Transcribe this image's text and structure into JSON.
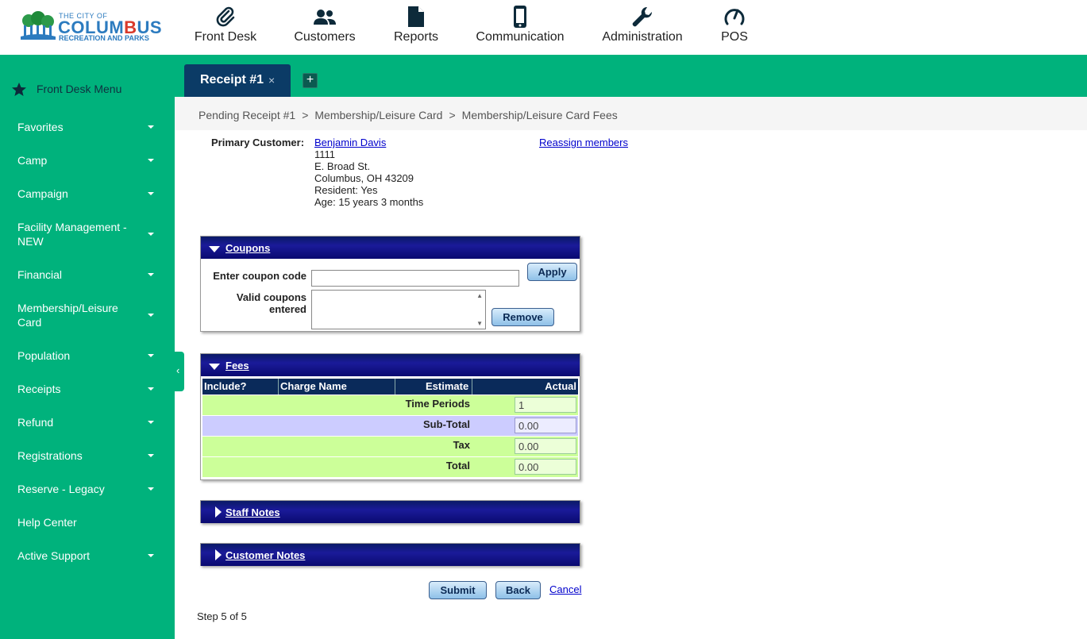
{
  "logo": {
    "line1": "THE CITY OF",
    "line2_a": "COLUM",
    "line2_b": "B",
    "line2_c": "US",
    "line3": "RECREATION AND PARKS"
  },
  "top_nav": [
    {
      "label": "Front Desk",
      "icon": "paperclip-icon"
    },
    {
      "label": "Customers",
      "icon": "users-icon"
    },
    {
      "label": "Reports",
      "icon": "document-icon"
    },
    {
      "label": "Communication",
      "icon": "mobile-phone-icon"
    },
    {
      "label": "Administration",
      "icon": "wrench-icon"
    },
    {
      "label": "POS",
      "icon": "gauge-icon"
    }
  ],
  "sidebar": {
    "header": "Front Desk Menu",
    "items": [
      {
        "label": "Favorites",
        "has_caret": true
      },
      {
        "label": "Camp",
        "has_caret": true
      },
      {
        "label": "Campaign",
        "has_caret": true
      },
      {
        "label": "Facility Management - NEW",
        "has_caret": true
      },
      {
        "label": "Financial",
        "has_caret": true
      },
      {
        "label": "Membership/Leisure Card",
        "has_caret": true
      },
      {
        "label": "Population",
        "has_caret": true
      },
      {
        "label": "Receipts",
        "has_caret": true
      },
      {
        "label": "Refund",
        "has_caret": true
      },
      {
        "label": "Registrations",
        "has_caret": true
      },
      {
        "label": "Reserve - Legacy",
        "has_caret": true
      },
      {
        "label": "Help Center",
        "has_caret": false
      },
      {
        "label": "Active Support",
        "has_caret": true
      }
    ]
  },
  "tabs": {
    "active_label": "Receipt #1",
    "close_glyph": "×",
    "add_glyph": "+"
  },
  "breadcrumb": {
    "items": [
      "Pending Receipt #1",
      "Membership/Leisure Card",
      "Membership/Leisure Card Fees"
    ],
    "separator": ">"
  },
  "customer": {
    "label": "Primary Customer:",
    "name": "Benjamin Davis",
    "line1": "1111",
    "line2": "E. Broad St.",
    "line3": "Columbus, OH 43209",
    "resident": "Resident: Yes",
    "age": "Age: 15 years 3 months",
    "reassign_link": "Reassign members"
  },
  "coupons": {
    "title": "Coupons",
    "code_label": "Enter coupon code",
    "code_value": "",
    "apply_label": "Apply",
    "valid_label_1": "Valid coupons",
    "valid_label_2": "entered",
    "remove_label": "Remove"
  },
  "fees": {
    "title": "Fees",
    "columns": [
      "Include?",
      "Charge Name",
      "Estimate",
      "Actual"
    ],
    "rows": [
      {
        "label": "Time Periods",
        "value": "1",
        "color": "#ccff99"
      },
      {
        "label": "Sub-Total",
        "value": "0.00",
        "color": "#ccccff"
      },
      {
        "label": "Tax",
        "value": "0.00",
        "color": "#ccff99"
      },
      {
        "label": "Total",
        "value": "0.00",
        "color": "#ccff99"
      }
    ]
  },
  "staff_notes": {
    "title": "Staff Notes"
  },
  "customer_notes": {
    "title": "Customer Notes"
  },
  "actions": {
    "submit": "Submit",
    "back": "Back",
    "cancel": "Cancel"
  },
  "step_text": "Step 5 of 5",
  "colors": {
    "brand_green": "#00b27c",
    "tab_navy": "#0b3b66",
    "panel_header": "#0a1a66"
  }
}
